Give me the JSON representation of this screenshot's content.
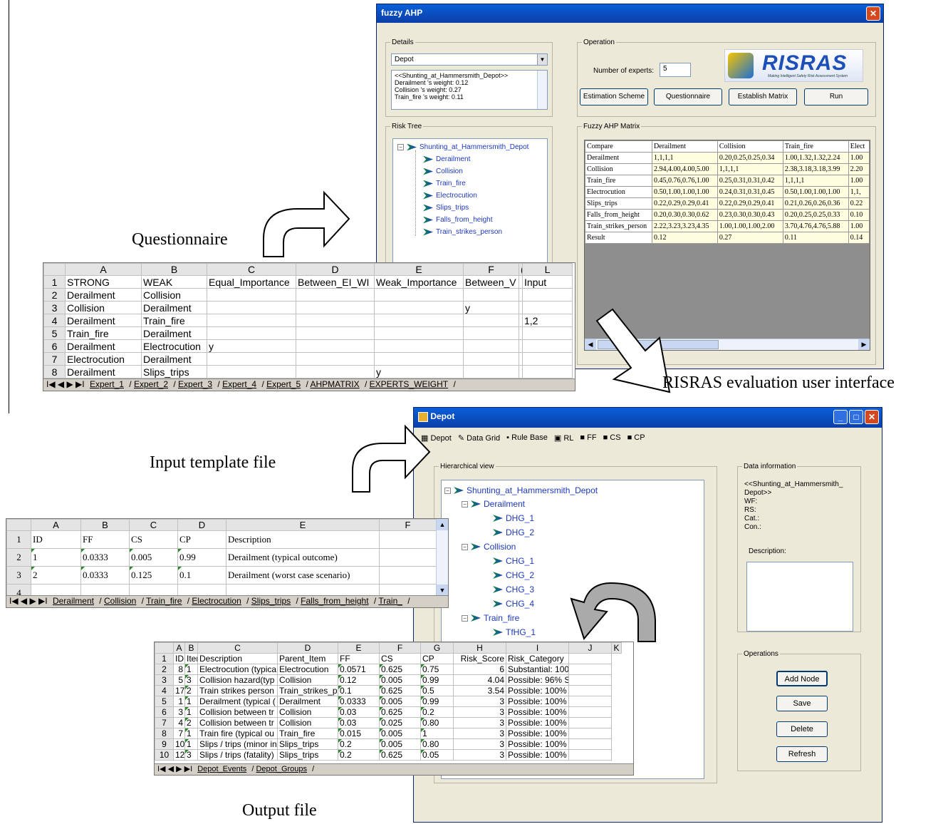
{
  "fuzzy_ahp": {
    "title": "fuzzy AHP",
    "details_legend": "Details",
    "details_select": "Depot",
    "details_text": [
      "<<Shunting_at_Hammersmith_Depot>>",
      "Derailment 's weight: 0.12",
      "Collision 's weight: 0.27",
      "Train_fire 's weight: 0.11"
    ],
    "operation_legend": "Operation",
    "num_experts_label": "Number of experts:",
    "num_experts_value": "5",
    "logo_text": "RISRAS",
    "logo_sub": "Making Intelligent Safety Risk Assessment System",
    "buttons": [
      "Estimation Scheme",
      "Questionnaire",
      "Establish Matrix",
      "Run"
    ],
    "risk_tree_legend": "Risk Tree",
    "tree_root": "Shunting_at_Hammersmith_Depot",
    "tree_children": [
      "Derailment",
      "Collision",
      "Train_fire",
      "Electrocution",
      "Slips_trips",
      "Falls_from_height",
      "Train_strikes_person"
    ],
    "matrix_legend": "Fuzzy AHP Matrix",
    "matrix_headers": [
      "Compare",
      "Derailment",
      "Collision",
      "Train_fire",
      "Elect"
    ],
    "matrix_rows": [
      [
        "Derailment",
        "1,1,1,1",
        "0.20,0.25,0.25,0.34",
        "1.00,1.32,1.32,2.24",
        "1.00"
      ],
      [
        "Collision",
        "2.94,4.00,4.00,5.00",
        "1,1,1,1",
        "2.38,3.18,3.18,3.99",
        "2.20"
      ],
      [
        "Train_fire",
        "0.45,0.76,0.76,1.00",
        "0.25,0.31,0.31,0.42",
        "1,1,1,1",
        "1.00"
      ],
      [
        "Electrocution",
        "0.50,1.00,1.00,1.00",
        "0.24,0.31,0.31,0.45",
        "0.50,1.00,1.00,1.00",
        "1,1,"
      ],
      [
        "Slips_trips",
        "0.22,0.29,0.29,0.41",
        "0.22,0.29,0.29,0.41",
        "0.21,0.26,0.26,0.36",
        "0.22"
      ],
      [
        "Falls_from_height",
        "0.20,0.30,0.30,0.62",
        "0.23,0.30,0.30,0.43",
        "0.20,0.25,0.25,0.33",
        "0.10"
      ],
      [
        "Train_strikes_person",
        "2.22,3.23,3.23,4.35",
        "1.00,1.00,1.00,2.00",
        "3.70,4.76,4.76,5.88",
        "1.00"
      ],
      [
        "Result",
        "0.12",
        "0.27",
        "0.11",
        "0.14"
      ]
    ]
  },
  "questionnaire_sheet": {
    "col_headers": [
      "",
      "A",
      "B",
      "C",
      "D",
      "E",
      "F",
      "(",
      "L"
    ],
    "rows": [
      [
        "1",
        "STRONG",
        "WEAK",
        "Equal_Importance",
        "Between_EI_WI",
        "Weak_Importance",
        "Between_V",
        "",
        "Input"
      ],
      [
        "2",
        "Derailment",
        "Collision",
        "",
        "",
        "",
        "",
        "",
        ""
      ],
      [
        "3",
        "Collision",
        "Derailment",
        "",
        "",
        "",
        "y",
        "",
        ""
      ],
      [
        "4",
        "Derailment",
        "Train_fire",
        "",
        "",
        "",
        "",
        "",
        "1,2"
      ],
      [
        "5",
        "Train_fire",
        "Derailment",
        "",
        "",
        "",
        "",
        "",
        ""
      ],
      [
        "6",
        "Derailment",
        "Electrocution",
        "y",
        "",
        "",
        "",
        "",
        ""
      ],
      [
        "7",
        "Electrocution",
        "Derailment",
        "",
        "",
        "",
        "",
        "",
        ""
      ],
      [
        "8",
        "Derailment",
        "Slips_trips",
        "",
        "",
        "y",
        "",
        "",
        ""
      ]
    ],
    "tabs": [
      "Expert_1",
      "Expert_2",
      "Expert_3",
      "Expert_4",
      "Expert_5",
      "AHPMATRIX",
      "EXPERTS_WEIGHT"
    ]
  },
  "depot_window": {
    "title": "Depot",
    "tabs": [
      "Depot",
      "Data Grid",
      "Rule Base",
      "RL",
      "FF",
      "CS",
      "CP"
    ],
    "hier_legend": "Hierarchical view",
    "tree": [
      {
        "label": "Shunting_at_Hammersmith_Depot",
        "level": 0
      },
      {
        "label": "Derailment",
        "level": 1
      },
      {
        "label": "DHG_1",
        "level": 2
      },
      {
        "label": "DHG_2",
        "level": 2
      },
      {
        "label": "Collision",
        "level": 1
      },
      {
        "label": "CHG_1",
        "level": 2
      },
      {
        "label": "CHG_2",
        "level": 2
      },
      {
        "label": "CHG_3",
        "level": 2
      },
      {
        "label": "CHG_4",
        "level": 2
      },
      {
        "label": "Train_fire",
        "level": 1
      },
      {
        "label": "TfHG_1",
        "level": 2
      }
    ],
    "data_info_legend": "Data information",
    "data_info_text": [
      "<<Shunting_at_Hammersmith_",
      "Depot>>",
      "WF:",
      "RS:",
      "Cat.:",
      "Con.:"
    ],
    "description_label": "Description:",
    "operations_legend": "Operations",
    "op_buttons": [
      "Add Node",
      "Save",
      "Delete",
      "Refresh"
    ]
  },
  "input_sheet": {
    "col_headers": [
      "",
      "A",
      "B",
      "C",
      "D",
      "E",
      "F"
    ],
    "rows": [
      [
        "1",
        "ID",
        "FF",
        "CS",
        "CP",
        "Description",
        ""
      ],
      [
        "2",
        "1",
        "0.0333",
        "0.005",
        "0.99",
        "Derailment (typical outcome)",
        ""
      ],
      [
        "3",
        "2",
        "0.0333",
        "0.125",
        "0.1",
        "Derailment (worst case scenario)",
        ""
      ],
      [
        "4",
        "",
        "",
        "",
        "",
        "",
        ""
      ]
    ],
    "tabs": [
      "Derailment",
      "Collision",
      "Train_fire",
      "Electrocution",
      "Slips_trips",
      "Falls_from_height",
      "Train_"
    ]
  },
  "output_sheet": {
    "col_headers": [
      "",
      "A",
      "B",
      "C",
      "D",
      "E",
      "F",
      "G",
      "H",
      "I",
      "J",
      "K"
    ],
    "rows": [
      [
        "1",
        "ID",
        "Item",
        "Description",
        "Parent_Item",
        "FF",
        "CS",
        "CP",
        "Risk_Score",
        "Risk_Category",
        ""
      ],
      [
        "2",
        "8",
        "1",
        "Electrocution (typica",
        "Electrocution",
        "0.0571",
        "0.625",
        "0.75",
        "6",
        "Substantial: 100%",
        ""
      ],
      [
        "3",
        "5",
        "3",
        "Collision hazard(typ",
        "Collision",
        "0.12",
        "0.005",
        "0.99",
        "4.04",
        "Possible: 96%  Substantial",
        ""
      ],
      [
        "4",
        "17",
        "2",
        "Train strikes person",
        "Train_strikes_p",
        "0.1",
        "0.625",
        "0.5",
        "3.54",
        "Possible: 100%",
        ""
      ],
      [
        "5",
        "1",
        "1",
        "Derailment (typical (",
        "Derailment",
        "0.0333",
        "0.005",
        "0.99",
        "3",
        "Possible: 100%",
        ""
      ],
      [
        "6",
        "3",
        "1",
        "Collision between tr",
        "Collision",
        "0.03",
        "0.625",
        "0.2",
        "3",
        "Possible: 100%",
        ""
      ],
      [
        "7",
        "4",
        "2",
        "Collision between tr",
        "Collision",
        "0.03",
        "0.025",
        "0.80",
        "3",
        "Possible: 100%",
        ""
      ],
      [
        "8",
        "7",
        "1",
        "Train fire (typical ou",
        "Train_fire",
        "0.015",
        "0.005",
        "1",
        "3",
        "Possible: 100%",
        ""
      ],
      [
        "9",
        "10",
        "1",
        "Slips / trips (minor in",
        "Slips_trips",
        "0.2",
        "0.005",
        "0.80",
        "3",
        "Possible: 100%",
        ""
      ],
      [
        "10",
        "12",
        "3",
        "Slips / trips (fatality)",
        "Slips_trips",
        "0.2",
        "0.625",
        "0.05",
        "3",
        "Possible: 100%",
        ""
      ]
    ],
    "tabs": [
      "Depot_Events",
      "Depot_Groups"
    ]
  },
  "captions": {
    "questionnaire": "Questionnaire",
    "risras": "RISRAS evaluation user interface",
    "input": "Input template file",
    "output": "Output file"
  }
}
